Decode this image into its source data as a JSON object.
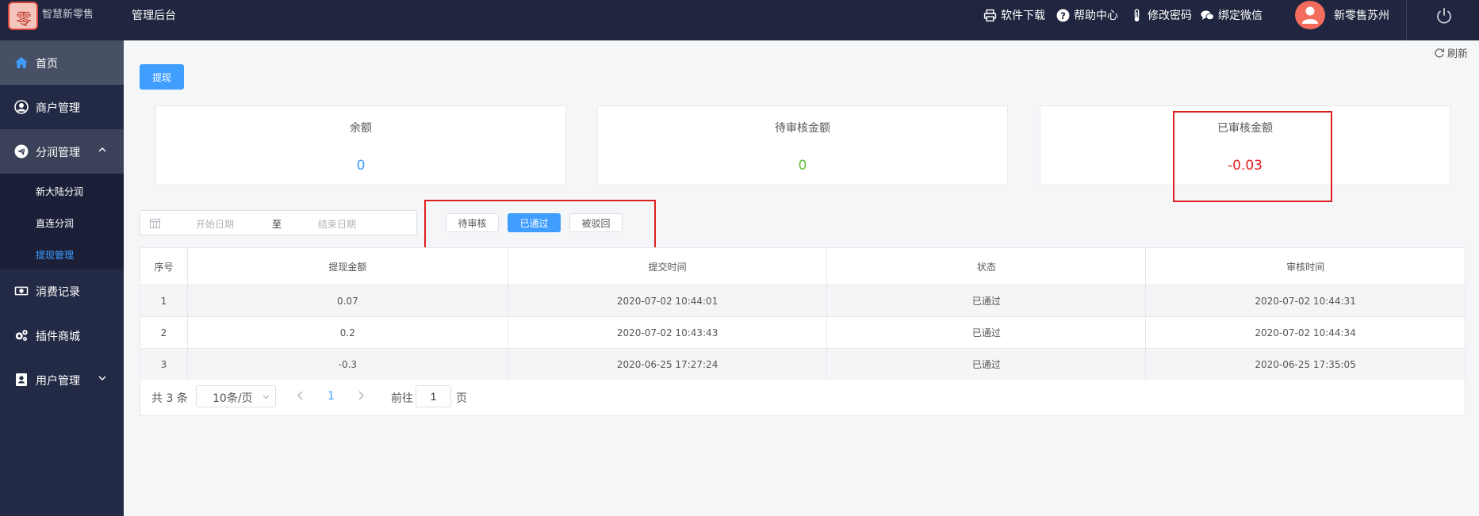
{
  "header": {
    "logo_text": "智慧新零售",
    "app_title": "管理后台",
    "links": [
      {
        "label": "软件下载",
        "icon": "printer-icon"
      },
      {
        "label": "帮助中心",
        "icon": "question-circle-icon"
      },
      {
        "label": "修改密码",
        "icon": "thermometer-icon"
      },
      {
        "label": "绑定微信",
        "icon": "chat-bubbles-icon"
      }
    ],
    "username": "新零售苏州"
  },
  "sidebar": {
    "items": [
      {
        "label": "首页",
        "icon": "home-icon"
      },
      {
        "label": "商户管理",
        "icon": "user-circle-icon"
      },
      {
        "label": "分润管理",
        "icon": "paper-plane-icon"
      },
      {
        "label": "消费记录",
        "icon": "money-icon"
      },
      {
        "label": "插件商城",
        "icon": "gears-icon"
      },
      {
        "label": "用户管理",
        "icon": "contact-book-icon"
      }
    ],
    "sub_items": [
      {
        "label": "新大陆分润"
      },
      {
        "label": "直连分润"
      },
      {
        "label": "提现管理"
      }
    ]
  },
  "toolbar": {
    "refresh_label": "刷新",
    "withdraw_label": "提现"
  },
  "cards": [
    {
      "label": "余额",
      "value": "0",
      "color": "#409eff"
    },
    {
      "label": "待审核金额",
      "value": "0",
      "color": "#67c23a"
    },
    {
      "label": "已审核金额",
      "value": "-0.03",
      "color": "#e02020"
    }
  ],
  "filters": {
    "start_placeholder": "开始日期",
    "separator": "至",
    "end_placeholder": "结束日期",
    "status_buttons": [
      "待审核",
      "已通过",
      "被驳回"
    ],
    "selected_status": "已通过"
  },
  "table": {
    "headers": [
      "序号",
      "提现金额",
      "提交时间",
      "状态",
      "审核时间"
    ],
    "rows": [
      [
        "1",
        "0.07",
        "2020-07-02 10:44:01",
        "已通过",
        "2020-07-02 10:44:31"
      ],
      [
        "2",
        "0.2",
        "2020-07-02 10:43:43",
        "已通过",
        "2020-07-02 10:44:34"
      ],
      [
        "3",
        "-0.3",
        "2020-06-25 17:27:24",
        "已通过",
        "2020-06-25 17:35:05"
      ]
    ]
  },
  "pagination": {
    "total_text": "共 3 条",
    "page_size": "10条/页",
    "current_page": "1",
    "goto_label": "前往",
    "goto_value": "1",
    "page_suffix": "页"
  },
  "colors": {
    "accent": "#409eff",
    "header_bg": "#20263f",
    "sidebar_bg": "#232a45",
    "highlight_border": "#e02020"
  }
}
